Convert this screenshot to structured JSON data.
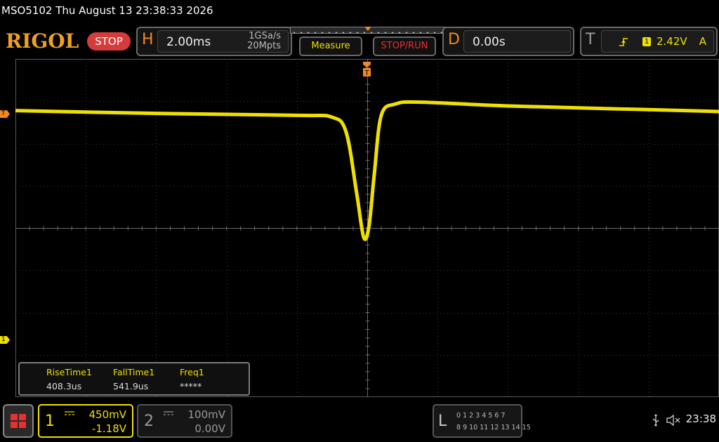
{
  "titlebar": {
    "text": "MSO5102  Thu August 13 23:38:33 2026"
  },
  "brand": {
    "logo": "RIGOL",
    "run_state": "STOP",
    "accent": "#f08a1c",
    "logo_color": "#f0a020",
    "stop_color": "#d43c3c"
  },
  "horizontal": {
    "letter": "H",
    "timebase": "2.00ms",
    "sample_rate": "1GSa/s",
    "memory_depth": "20Mpts"
  },
  "buttons": {
    "measure": "Measure",
    "stop_run": "STOP/RUN"
  },
  "delay": {
    "letter": "D",
    "value": "0.00s"
  },
  "trigger": {
    "letter": "T",
    "edge_icon": "rising-edge-icon",
    "source": "1",
    "level": "2.42V",
    "mode": "A"
  },
  "markers": {
    "trigger": "T",
    "channel1": "1"
  },
  "measurements": [
    {
      "label": "RiseTime1",
      "value": "408.3us"
    },
    {
      "label": "FallTime1",
      "value": "541.9us"
    },
    {
      "label": "Freq1",
      "value": "*****"
    }
  ],
  "channels": [
    {
      "num": "1",
      "scale": "450mV",
      "offset": "-1.18V",
      "color": "#f0e000",
      "active": true
    },
    {
      "num": "2",
      "scale": "100mV",
      "offset": "0.00V",
      "color": "#9a9a9a",
      "active": false
    }
  ],
  "logic": {
    "letter": "L",
    "row1": "0 1 2 3  4 5 6 7",
    "row2": "8 9 10 11 12 13 14 15"
  },
  "status": {
    "usb_icon": "usb-icon",
    "sound_icon": "speaker-muted-icon",
    "clock": "23:38"
  },
  "trace": {
    "color": "#f0e000",
    "unit_x": "ms",
    "unit_y": "V",
    "points": [
      [
        -10.0,
        2.43
      ],
      [
        -6.0,
        2.4
      ],
      [
        -2.0,
        2.38
      ],
      [
        -1.0,
        2.36
      ],
      [
        -0.6,
        2.2
      ],
      [
        -0.3,
        1.55
      ],
      [
        -0.1,
        1.08
      ],
      [
        0.05,
        1.2
      ],
      [
        0.2,
        1.75
      ],
      [
        0.4,
        2.38
      ],
      [
        0.8,
        2.5
      ],
      [
        1.5,
        2.52
      ],
      [
        4.0,
        2.48
      ],
      [
        8.0,
        2.44
      ],
      [
        10.0,
        2.42
      ]
    ]
  }
}
